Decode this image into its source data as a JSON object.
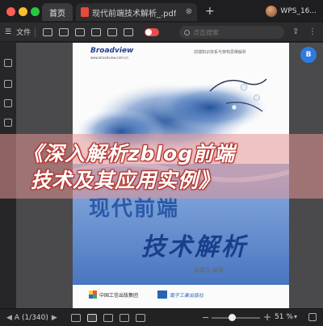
{
  "tabs": {
    "home_label": "首页",
    "doc_title": "现代前端技术解析_.pdf",
    "close_symbol": "⊗",
    "new_tab_symbol": "+"
  },
  "user": {
    "name": "WPS_16..."
  },
  "toolbar": {
    "file_label": "文件",
    "search_placeholder": "点击搜索"
  },
  "page": {
    "publisher": "Broadview",
    "publisher_sub": "www.broadview.com.cn",
    "series": "前端知识体系与架构思维解析",
    "title_main": "现代前端",
    "title_sub": "技术解析",
    "author": "张成文 编著",
    "press1": "中国工信出版集团",
    "press2": "電子工業出版社"
  },
  "banner": {
    "line1": "《深入解析zblog前端",
    "line2": "技术及其应用实例》"
  },
  "fab_label": "B",
  "status": {
    "page_indicator": "A  (1/340)",
    "zoom_value": "51 %",
    "zoom_fraction": 0.42,
    "zoom_minus": "−",
    "zoom_plus": "+"
  },
  "colors": {
    "accent": "#2d7be0",
    "banner_stroke": "#b03030",
    "title_blue": "#2a5aa8"
  }
}
